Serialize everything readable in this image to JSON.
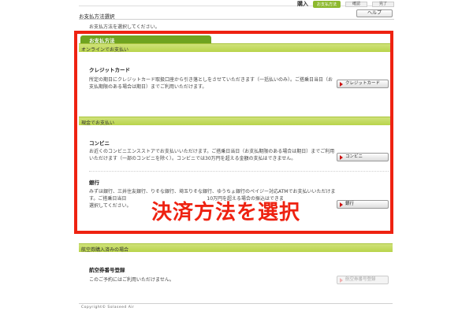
{
  "steps": {
    "label": "購入",
    "active": "お支払方法",
    "step_a": "確認",
    "step_b": "完了"
  },
  "header": {
    "title": "お支払方法選択",
    "help_label": "ヘルプ",
    "instruction": "お支払方法を選択してください。"
  },
  "tab": {
    "label": "お支払方法"
  },
  "sections": {
    "online": "オンラインでお支払い",
    "cash": "現金でお支払い",
    "voucher": "航空券購入済みの場合"
  },
  "credit": {
    "title": "クレジットカード",
    "desc": "所定の期日にクレジットカード取扱口座から引き落としをさせていただきます（一括払いのみ）。ご搭乗日当日（お支払期限のある場合は期日）までご利用いただけます。",
    "button": "クレジットカード"
  },
  "convenience": {
    "title": "コンビニ",
    "desc": "お近くのコンビニエンスストアでお支払いいただけます。ご搭乗日当日（お支払期限のある場合は期日）までご利用いただけます（一部のコンビニを除く）。コンビニでは30万円を超える金額の支払はできません。",
    "button": "コンビニ"
  },
  "bank": {
    "title": "銀行",
    "desc": "みずほ銀行、三井住友銀行、りそな銀行、埼玉りそな銀行、ゆうちょ銀行のペイジー対応ATMでお支払いいただけます。ご搭乗日当日　　　　　　　　　　　　　　　　　10万円を超える場合の振込はできま　　　　　　　　　　　　　　　　　選択してください。",
    "button": "銀行"
  },
  "voucher": {
    "title": "航空券番号登録",
    "desc": "このご予約にはご利用いただけません。",
    "button": "航空券番号登録"
  },
  "overlay": {
    "text": "決済方法を選択"
  },
  "footer": {
    "copyright": "Copyright© Solaseed Air"
  }
}
